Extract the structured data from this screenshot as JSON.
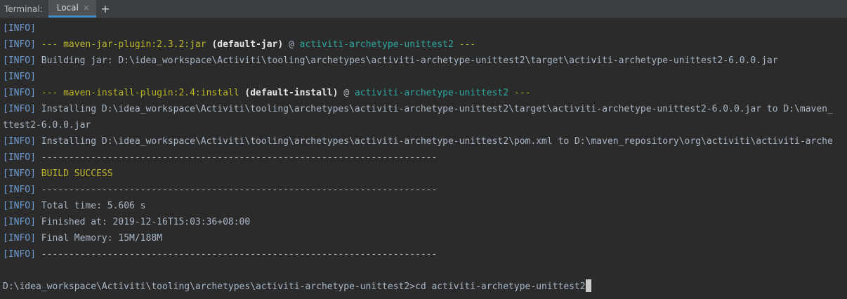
{
  "tabbar": {
    "title": "Terminal:",
    "tab_label": "Local",
    "tab_close": "×",
    "add_tab": "+"
  },
  "console": {
    "info_tag": "[INFO]",
    "sep": "------------------------------------------------------------------------",
    "jar_plugin": {
      "dashes_l": "---",
      "plugin": "maven-jar-plugin:2.3.2:jar",
      "exec": "(default-jar)",
      "at": "@",
      "artifact": "activiti-archetype-unittest2",
      "dashes_r": "---"
    },
    "building_jar": "Building jar: D:\\idea_workspace\\Activiti\\tooling\\archetypes\\activiti-archetype-unittest2\\target\\activiti-archetype-unittest2-6.0.0.jar",
    "install_plugin": {
      "dashes_l": "---",
      "plugin": "maven-install-plugin:2.4:install",
      "exec": "(default-install)",
      "at": "@",
      "artifact": "activiti-archetype-unittest2",
      "dashes_r": "---"
    },
    "installing_jar": "Installing D:\\idea_workspace\\Activiti\\tooling\\archetypes\\activiti-archetype-unittest2\\target\\activiti-archetype-unittest2-6.0.0.jar to D:\\maven_",
    "installing_jar_wrap": "ttest2-6.0.0.jar",
    "installing_pom": "Installing D:\\idea_workspace\\Activiti\\tooling\\archetypes\\activiti-archetype-unittest2\\pom.xml to D:\\maven_repository\\org\\activiti\\activiti-arche",
    "build_success": "BUILD SUCCESS",
    "total_time": "Total time: 5.606 s",
    "finished_at": "Finished at: 2019-12-16T15:03:36+08:00",
    "final_memory": "Final Memory: 15M/188M",
    "prompt_path": "D:\\idea_workspace\\Activiti\\tooling\\archetypes\\activiti-archetype-unittest2>",
    "prompt_command": "cd activiti-archetype-unittest2"
  },
  "colors": {
    "background": "#2b2b2b",
    "info_tag": "#6f9bd1",
    "plugin": "#bbb529",
    "artifact": "#30a8a0",
    "text": "#a9b7c6"
  }
}
